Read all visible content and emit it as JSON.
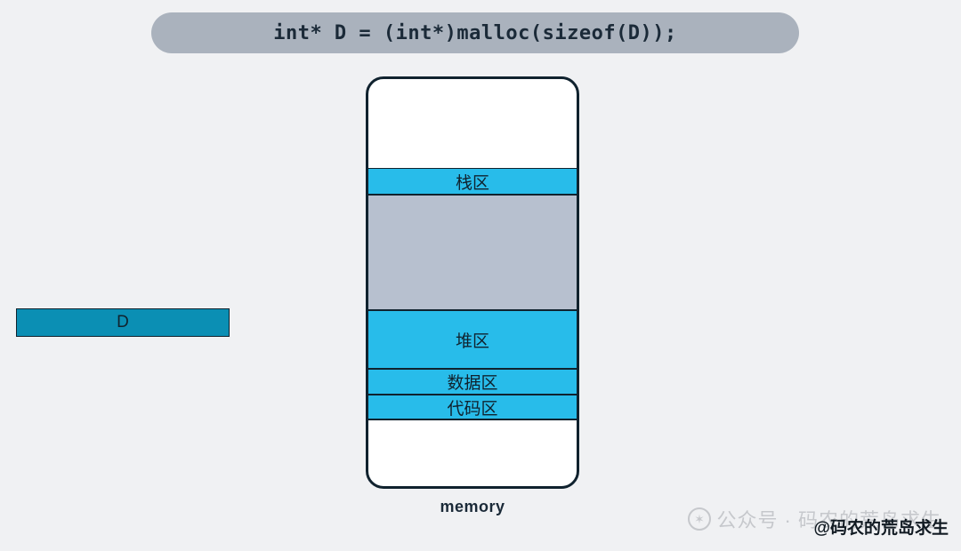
{
  "code": "int* D = (int*)malloc(sizeof(D));",
  "memory": {
    "caption": "memory",
    "regions": {
      "stack": "栈区",
      "free": "",
      "heap": "堆区",
      "data": "数据区",
      "code": "代码区"
    }
  },
  "pointer_block": {
    "label": "D"
  },
  "watermark": {
    "faint": "公众号 · 码农的荒岛求生",
    "dark": "@码农的荒岛求生"
  },
  "colors": {
    "bg": "#f0f1f3",
    "pill": "#aab2bd",
    "region": "#28bcea",
    "free": "#b7c0cf",
    "pointer": "#0b8fb4",
    "border": "#10222e"
  }
}
